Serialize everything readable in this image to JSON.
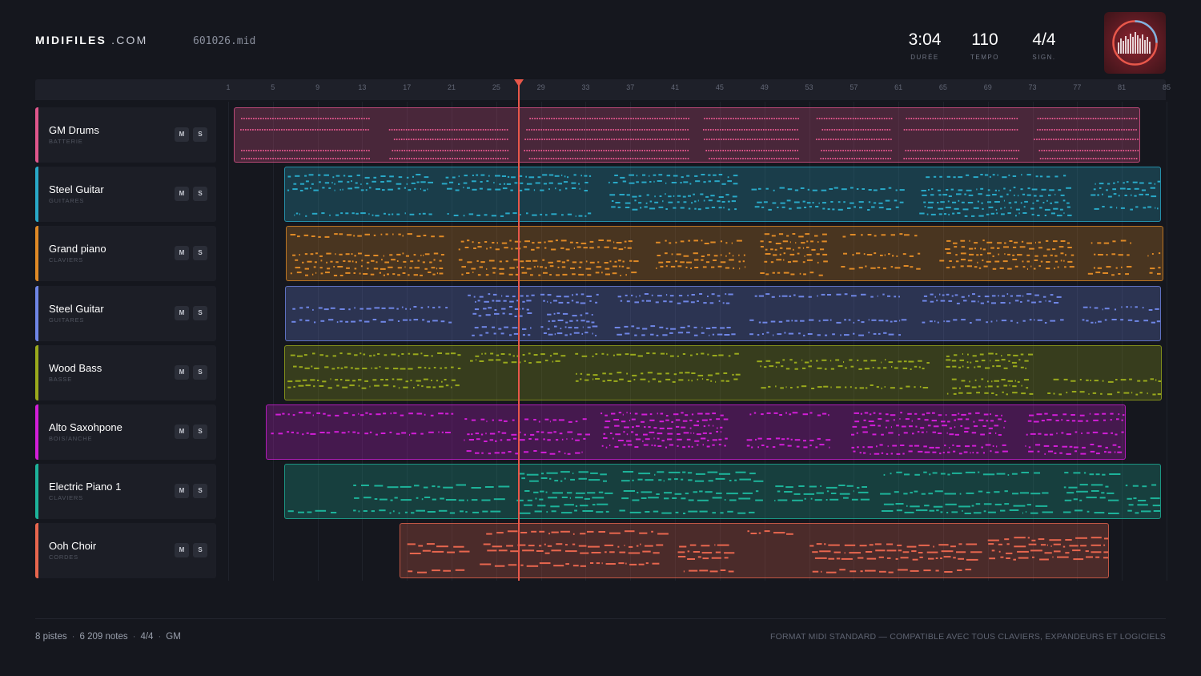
{
  "brand": {
    "name_strong": "MIDIFILES",
    "name_light": ".COM"
  },
  "file": {
    "name": "601026.mid"
  },
  "stats": [
    {
      "value": "3:04",
      "label": "DURÉE"
    },
    {
      "value": "110",
      "label": "TEMPO"
    },
    {
      "value": "4/4",
      "label": "SIGN."
    }
  ],
  "ruler": {
    "bars": [
      "1",
      "5",
      "9",
      "13",
      "17",
      "21",
      "25",
      "29",
      "33",
      "37",
      "41",
      "45",
      "49",
      "53",
      "57",
      "61",
      "65",
      "69",
      "73",
      "77",
      "81",
      "85"
    ]
  },
  "playhead": {
    "bar": 27
  },
  "tracks": [
    {
      "name": "GM Drums",
      "category": "BATTERIE",
      "mute": "M",
      "solo": "S",
      "color": "#e0568c"
    },
    {
      "name": "Steel Guitar",
      "category": "GUITARES",
      "mute": "M",
      "solo": "S",
      "color": "#29a9c8"
    },
    {
      "name": "Grand piano",
      "category": "CLAVIERS",
      "mute": "M",
      "solo": "S",
      "color": "#e08a26"
    },
    {
      "name": "Steel Guitar",
      "category": "GUITARES",
      "mute": "M",
      "solo": "S",
      "color": "#6f86e6"
    },
    {
      "name": "Wood Bass",
      "category": "BASSE",
      "mute": "M",
      "solo": "S",
      "color": "#9aaa1c"
    },
    {
      "name": "Alto Saxohpone",
      "category": "BOIS/ANCHE",
      "mute": "M",
      "solo": "S",
      "color": "#d21ed8"
    },
    {
      "name": "Electric Piano 1",
      "category": "CLAVIERS",
      "mute": "M",
      "solo": "S",
      "color": "#1db39a"
    },
    {
      "name": "Ooh Choir",
      "category": "CORDES",
      "mute": "M",
      "solo": "S",
      "color": "#e8664e"
    }
  ],
  "footer": {
    "tracks_count": "8 pistes",
    "notes_count": "6 209 notes",
    "signature": "4/4",
    "standard": "GM",
    "tagline": "FORMAT MIDI STANDARD — COMPATIBLE AVEC TOUS CLAVIERS, EXPANDEURS ET LOGICIELS"
  }
}
